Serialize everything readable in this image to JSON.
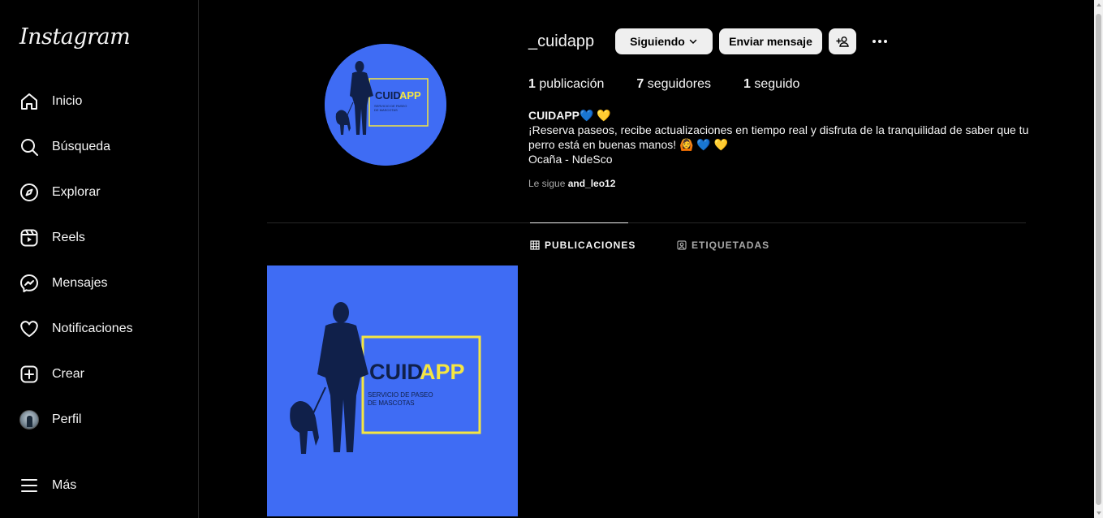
{
  "sidebar": {
    "logo": "Instagram",
    "items": [
      {
        "label": "Inicio",
        "icon": "home-icon"
      },
      {
        "label": "Búsqueda",
        "icon": "search-icon"
      },
      {
        "label": "Explorar",
        "icon": "compass-icon"
      },
      {
        "label": "Reels",
        "icon": "reels-icon"
      },
      {
        "label": "Mensajes",
        "icon": "messenger-icon"
      },
      {
        "label": "Notificaciones",
        "icon": "heart-icon"
      },
      {
        "label": "Crear",
        "icon": "plus-square-icon"
      },
      {
        "label": "Perfil",
        "icon": "profile-avatar"
      }
    ],
    "more": {
      "label": "Más",
      "icon": "hamburger-icon"
    }
  },
  "profile": {
    "username": "_cuidapp",
    "following_button": "Siguiendo",
    "message_button": "Enviar mensaje",
    "stats": {
      "posts_count": "1",
      "posts_label": " publicación",
      "followers_count": "7",
      "followers_label": " seguidores",
      "following_count": "1",
      "following_label": " seguido"
    },
    "bio": {
      "name": "CUIDAPP💙 💛",
      "text": "¡Reserva paseos, recibe actualizaciones en tiempo real y disfruta de la tranquilidad de saber que tu perro está en buenas manos! 🙆 💙 💛",
      "location": "Ocaña - NdeSco"
    },
    "followed_by": {
      "prefix": "Le sigue ",
      "user": "and_leo12"
    }
  },
  "tabs": {
    "posts": "PUBLICACIONES",
    "tagged": "ETIQUETADAS"
  },
  "brand": {
    "logo_word_a": "CUID",
    "logo_word_b": "APP",
    "logo_sub_1": "SERVICIO DE PASEO",
    "logo_sub_2": "DE MASCOTAS"
  },
  "colors": {
    "background": "#000000",
    "brand_blue": "#3f6cf4",
    "brand_yellow": "#f5e642",
    "silhouette": "#10204a"
  }
}
